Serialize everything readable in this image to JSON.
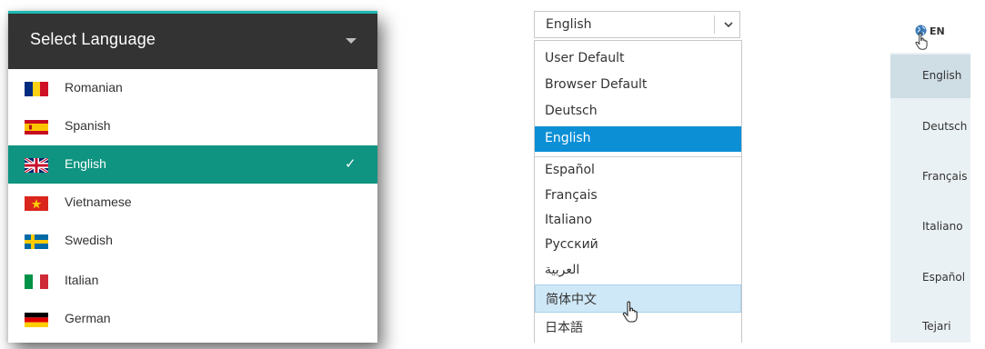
{
  "panel1": {
    "title": "Select Language",
    "items": [
      {
        "label": "Romanian",
        "flag": "flag-romania-icon"
      },
      {
        "label": "Spanish",
        "flag": "flag-spain-icon"
      },
      {
        "label": "English",
        "flag": "flag-uk-icon",
        "selected": true
      },
      {
        "label": "Vietnamese",
        "flag": "flag-vietnam-icon"
      },
      {
        "label": "Swedish",
        "flag": "flag-sweden-icon"
      },
      {
        "label": "Italian",
        "flag": "flag-italy-icon"
      },
      {
        "label": "German",
        "flag": "flag-germany-icon"
      }
    ],
    "check": "✓",
    "colors": {
      "header": "#333333",
      "accent": "#1fb9b0",
      "selected": "#0e9480"
    }
  },
  "panel2": {
    "selected_value": "English",
    "options": [
      "User Default",
      "Browser Default",
      "Deutsch",
      "English",
      "Español",
      "Français",
      "Italiano",
      "Русский",
      "العربية",
      "简体中文",
      "日本語"
    ],
    "colors": {
      "selected": "#0d8fd6",
      "hover": "#cfe8f7"
    }
  },
  "panel3": {
    "current": "EN",
    "languages": [
      "English",
      "Deutsch",
      "Français",
      "Italiano",
      "Español",
      "Tejari"
    ],
    "colors": {
      "background": "#eaf1f4",
      "active": "#cfdde5"
    }
  }
}
